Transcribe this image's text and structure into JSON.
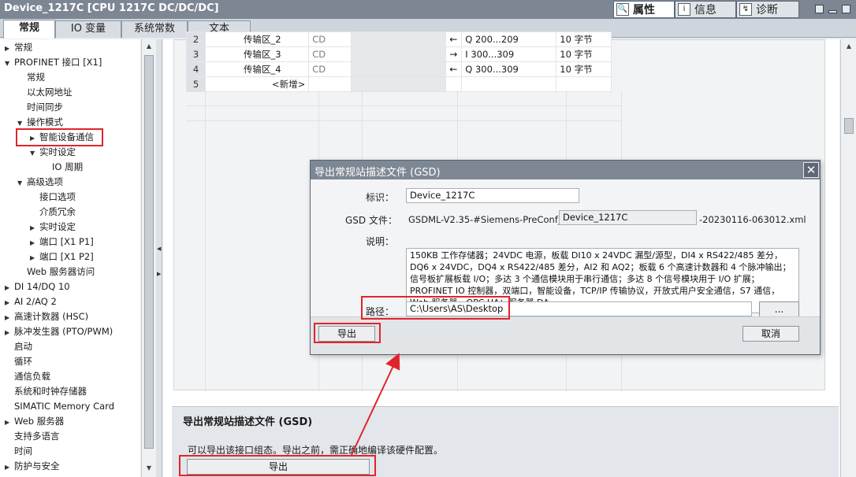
{
  "titlebar": {
    "title": "Device_1217C [CPU 1217C DC/DC/DC]",
    "tabs": [
      {
        "label": "属性",
        "icon": "properties-icon"
      },
      {
        "label": "信息",
        "icon": "info-icon"
      },
      {
        "label": "诊断",
        "icon": "diagnostics-icon"
      }
    ]
  },
  "subtabs": [
    "常规",
    "IO 变量",
    "系统常数",
    "文本"
  ],
  "tree": {
    "items": [
      {
        "label": "常规",
        "level": 0,
        "arrow": "right"
      },
      {
        "label": "PROFINET 接口 [X1]",
        "level": 0,
        "arrow": "down"
      },
      {
        "label": "常规",
        "level": 1,
        "arrow": ""
      },
      {
        "label": "以太网地址",
        "level": 1,
        "arrow": ""
      },
      {
        "label": "时间同步",
        "level": 1,
        "arrow": ""
      },
      {
        "label": "操作模式",
        "level": 1,
        "arrow": "down"
      },
      {
        "label": "智能设备通信",
        "level": 2,
        "arrow": "right"
      },
      {
        "label": "实时设定",
        "level": 2,
        "arrow": "down"
      },
      {
        "label": "IO 周期",
        "level": 3,
        "arrow": ""
      },
      {
        "label": "高级选项",
        "level": 1,
        "arrow": "down"
      },
      {
        "label": "接口选项",
        "level": 2,
        "arrow": ""
      },
      {
        "label": "介质冗余",
        "level": 2,
        "arrow": ""
      },
      {
        "label": "实时设定",
        "level": 2,
        "arrow": "right"
      },
      {
        "label": "端口 [X1 P1]",
        "level": 2,
        "arrow": "right"
      },
      {
        "label": "端口 [X1 P2]",
        "level": 2,
        "arrow": "right"
      },
      {
        "label": "Web 服务器访问",
        "level": 1,
        "arrow": ""
      },
      {
        "label": "DI 14/DQ 10",
        "level": 0,
        "arrow": "right"
      },
      {
        "label": "AI 2/AQ 2",
        "level": 0,
        "arrow": "right"
      },
      {
        "label": "高速计数器 (HSC)",
        "level": 0,
        "arrow": "right"
      },
      {
        "label": "脉冲发生器 (PTO/PWM)",
        "level": 0,
        "arrow": "right"
      },
      {
        "label": "启动",
        "level": 0,
        "arrow": ""
      },
      {
        "label": "循环",
        "level": 0,
        "arrow": ""
      },
      {
        "label": "通信负载",
        "level": 0,
        "arrow": ""
      },
      {
        "label": "系统和时钟存储器",
        "level": 0,
        "arrow": ""
      },
      {
        "label": "SIMATIC Memory Card",
        "level": 0,
        "arrow": ""
      },
      {
        "label": "Web 服务器",
        "level": 0,
        "arrow": "right"
      },
      {
        "label": "支持多语言",
        "level": 0,
        "arrow": ""
      },
      {
        "label": "时间",
        "level": 0,
        "arrow": ""
      },
      {
        "label": "防护与安全",
        "level": 0,
        "arrow": "right"
      }
    ]
  },
  "grid": {
    "rows": [
      {
        "num": "2",
        "name": "传输区_2",
        "type": "CD",
        "dir": "←",
        "addr": "Q 200...209",
        "len": "10 字节"
      },
      {
        "num": "3",
        "name": "传输区_3",
        "type": "CD",
        "dir": "→",
        "addr": "I 300...309",
        "len": "10 字节"
      },
      {
        "num": "4",
        "name": "传输区_4",
        "type": "CD",
        "dir": "←",
        "addr": "Q 300...309",
        "len": "10 字节"
      }
    ],
    "add_row": {
      "num": "5",
      "label": "<新增>"
    }
  },
  "bottom": {
    "heading": "导出常规站描述文件 (GSD)",
    "description": "可以导出该接口组态。导出之前，需正确地编译该硬件配置。",
    "export_label": "导出"
  },
  "dialog": {
    "title": "导出常规站描述文件 (GSD)",
    "close_glyph": "✕",
    "id_label": "标识：",
    "id_value": "Device_1217C",
    "gsd_label": "GSD 文件：",
    "gsd_prefix": "GSDML-V2.35-#Siemens-PreConf_",
    "gsd_name": "Device_1217C",
    "gsd_suffix": "-20230116-063012.xml",
    "desc_label": "说明：",
    "desc_lines": [
      "150KB 工作存储器；24VDC 电源，板载 DI10 x 24VDC 漏型/源型，DI4 x RS422/485 差分，",
      "DQ6 x 24VDC，DQ4 x RS422/485 差分，AI2 和 AQ2；板载 6 个高速计数器和 4 个脉冲输出；",
      "信号板扩展板载 I/O；多达 3 个通信模块用于串行通信；多达 8 个信号模块用于 I/O 扩展；",
      "PROFINET IO 控制器，双端口，智能设备，TCP/IP 传输协议，开放式用户安全通信，S7 通信，",
      "Web 服务器，OPC UA：服务器 DA"
    ],
    "path_label": "路径：",
    "path_value": "C:\\Users\\AS\\Desktop",
    "browse_label": "...",
    "export_label": "导出",
    "cancel_label": "取消"
  },
  "colors": {
    "titlebar": "#7d8794",
    "annotation": "#e0242c"
  }
}
